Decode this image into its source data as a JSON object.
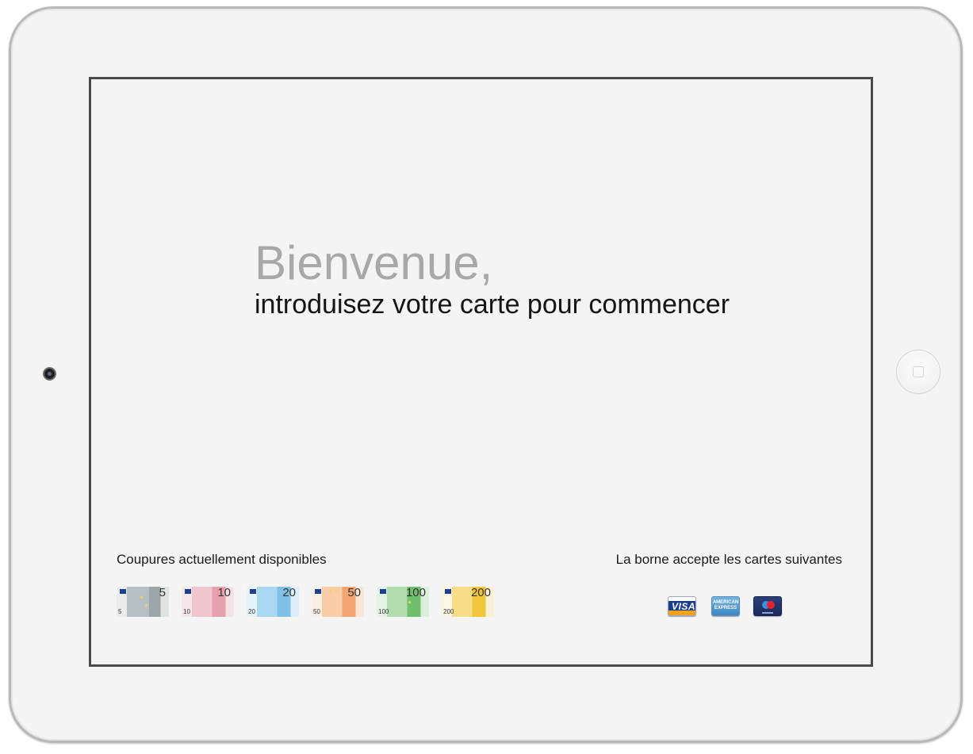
{
  "welcome": {
    "title": "Bienvenue,",
    "instruction": "introduisez votre carte pour commencer"
  },
  "banknotes": {
    "label": "Coupures actuellement disponibles",
    "items": [
      {
        "value": "5",
        "color": "#9aa6a8"
      },
      {
        "value": "10",
        "color": "#e8a0ad"
      },
      {
        "value": "20",
        "color": "#7ec0e6"
      },
      {
        "value": "50",
        "color": "#f4a672"
      },
      {
        "value": "100",
        "color": "#6fbf6e"
      },
      {
        "value": "200",
        "color": "#f1c63c"
      }
    ]
  },
  "cards": {
    "label": "La borne accepte les cartes suivantes",
    "items": [
      {
        "icon": "visa-card-icon",
        "text": "VISA"
      },
      {
        "icon": "american-express-card-icon",
        "text": "AMERICAN EXPRESS"
      },
      {
        "icon": "maestro-card-icon"
      }
    ]
  },
  "device": {
    "frame_color": "#f4f4f4",
    "screen_border_color": "#4a4a4a"
  }
}
